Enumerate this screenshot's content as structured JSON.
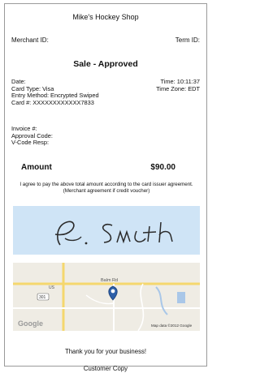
{
  "receipt": {
    "shop_name": "Mike's Hockey Shop",
    "merchant_id_label": "Merchant ID:",
    "term_id_label": "Term ID:",
    "status": "Sale - Approved",
    "date_label": "Date:",
    "card_type": "Card Type: Visa",
    "entry_method": "Entry Method: Encrypted Swiped",
    "card_number": "Card #: XXXXXXXXXXXX7833",
    "time": "Time: 10:11:37",
    "time_zone": "Time Zone: EDT",
    "invoice_label": "Invoice #:",
    "approval_code_label": "Approval Code:",
    "vcode_label": "V-Code Resp:",
    "amount_label": "Amount",
    "amount_value": "$90.00",
    "agreement_text": "I agree to pay the above total amount according to the card issuer agreement. (Merchant agreement if credit voucher)",
    "signature_text": "A. Smith",
    "thanks_text": "Thank you for your business!",
    "copy_label": "Customer Copy"
  },
  "map": {
    "road_label_top": "Balm Rd",
    "road_label_left": "US",
    "road_label_shield": "301",
    "logo": "Google",
    "attribution": "Map data ©2012 Google",
    "pin_icon": "map-pin-icon",
    "colors": {
      "background": "#efece4",
      "road": "#f5d76e",
      "minor_road": "#ffffff",
      "water": "#a9c7e8",
      "pin": "#2d5fa8"
    }
  }
}
